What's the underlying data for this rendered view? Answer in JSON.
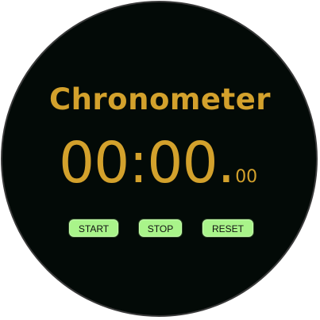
{
  "app": {
    "title": "Chronometer"
  },
  "timer": {
    "main": "00:00.",
    "fraction": "00"
  },
  "controls": {
    "start_label": "START",
    "stop_label": "STOP",
    "reset_label": "RESET"
  },
  "colors": {
    "face": "#030a07",
    "accent": "#d3a12c",
    "button": "#a9f48a"
  }
}
